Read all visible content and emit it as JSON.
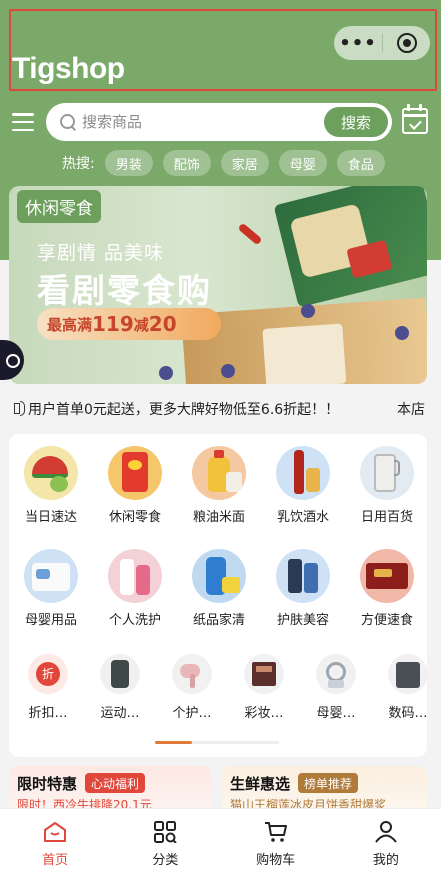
{
  "app": {
    "logo_text": "Tigshop"
  },
  "capsule": {
    "more_icon": "more-dots-icon",
    "close_icon": "target-icon"
  },
  "search": {
    "placeholder": "搜索商品",
    "button_label": "搜索"
  },
  "hot": {
    "label": "热搜:",
    "tags": [
      "男装",
      "配饰",
      "家居",
      "母婴",
      "食品"
    ]
  },
  "banner": {
    "badge": "休闲零食",
    "subtitle": "享剧情 品美味",
    "title": "看剧零食购",
    "promo_prefix": "最高满",
    "promo_amount1": "119",
    "promo_mid": "减",
    "promo_amount2": "20"
  },
  "notice": {
    "text": "用户首单0元起送，更多大牌好物低至6.6折起！！",
    "right": "本店"
  },
  "categories": [
    {
      "label": "当日速达"
    },
    {
      "label": "休闲零食"
    },
    {
      "label": "粮油米面"
    },
    {
      "label": "乳饮酒水"
    },
    {
      "label": "日用百货"
    },
    {
      "label": "母婴用品"
    },
    {
      "label": "个人洗护"
    },
    {
      "label": "纸品家清"
    },
    {
      "label": "护肤美容"
    },
    {
      "label": "方便速食"
    }
  ],
  "small_categories": [
    {
      "label": "折扣…",
      "icon_text": "折"
    },
    {
      "label": "运动…"
    },
    {
      "label": "个护…"
    },
    {
      "label": "彩妆…"
    },
    {
      "label": "母婴…"
    },
    {
      "label": "数码…"
    }
  ],
  "scroll_indicator": {
    "progress": 0.3
  },
  "promos": [
    {
      "title": "限时特惠",
      "badge": "心动福利",
      "subtitle": "限时！西冷牛排降20.1元",
      "badge_color": "#e0473a",
      "sub_color": "#e0473a"
    },
    {
      "title": "生鲜惠选",
      "badge": "榜单推荐",
      "subtitle": "猫山王榴莲冰皮月饼香甜爆浆",
      "badge_color": "#b07a3a",
      "sub_color": "#b07a3a"
    }
  ],
  "tabbar": [
    {
      "label": "首页",
      "icon": "home-icon",
      "active": true
    },
    {
      "label": "分类",
      "icon": "category-icon",
      "active": false
    },
    {
      "label": "购物车",
      "icon": "cart-icon",
      "active": false
    },
    {
      "label": "我的",
      "icon": "user-icon",
      "active": false
    }
  ],
  "colors": {
    "brand_green": "#7aa96a",
    "accent_red": "#e0473a",
    "indicator": "#e07b39"
  }
}
